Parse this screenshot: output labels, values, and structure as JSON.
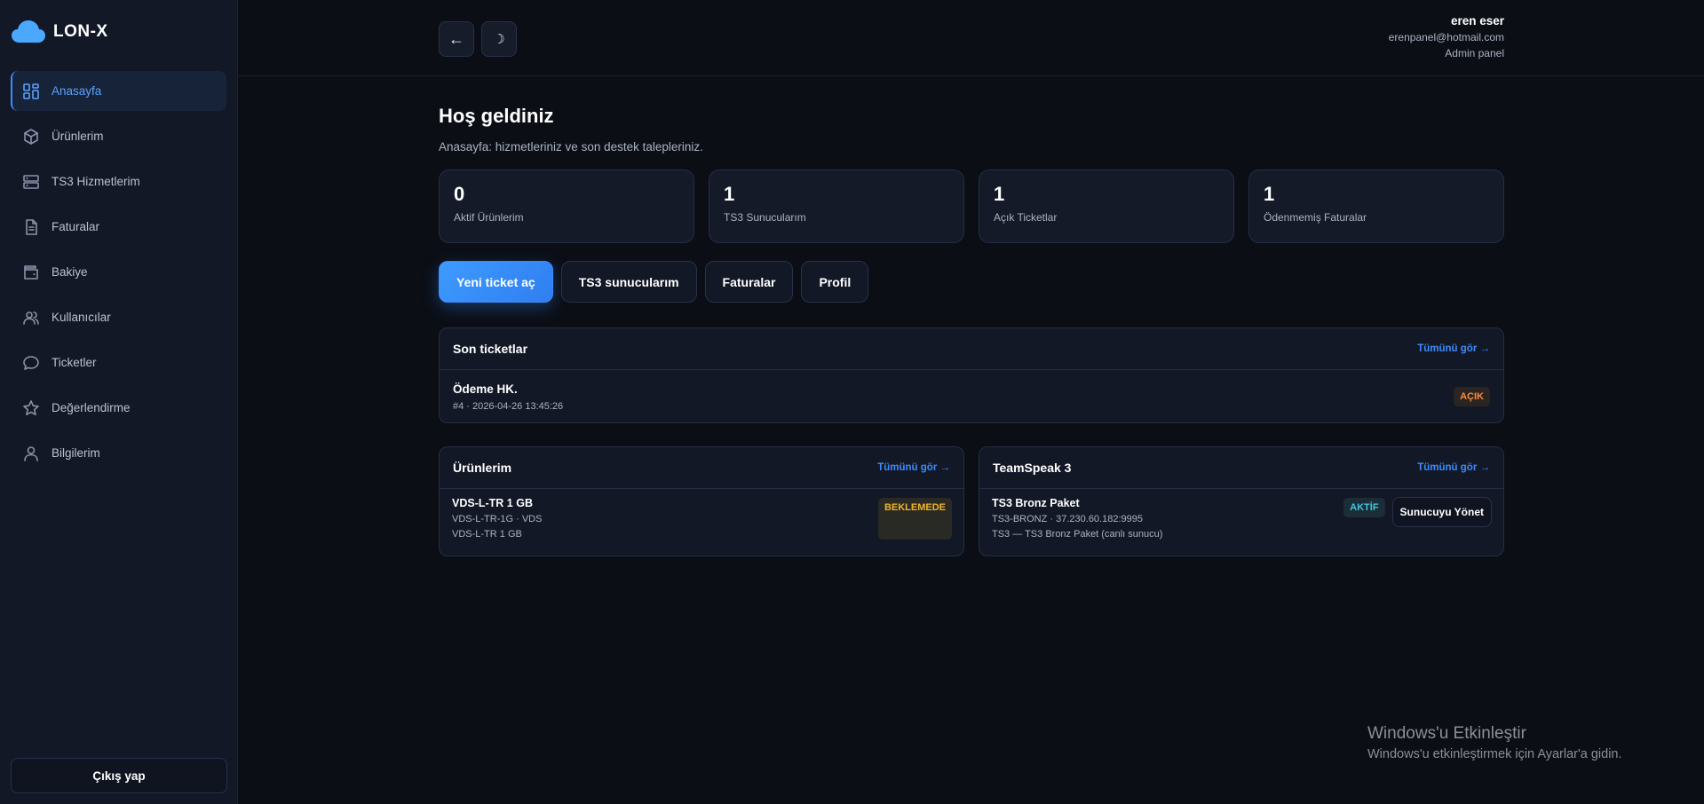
{
  "brand": {
    "name": "LON-X",
    "accent": "#3d8bfd"
  },
  "sidebar": {
    "items": [
      {
        "label": "Anasayfa",
        "icon": "dashboard-icon",
        "active": true
      },
      {
        "label": "Ürünlerim",
        "icon": "box-icon"
      },
      {
        "label": "TS3 Hizmetlerim",
        "icon": "server-icon"
      },
      {
        "label": "Faturalar",
        "icon": "document-icon"
      },
      {
        "label": "Bakiye",
        "icon": "wallet-icon"
      },
      {
        "label": "Kullanıcılar",
        "icon": "users-icon"
      },
      {
        "label": "Ticketler",
        "icon": "chat-icon"
      },
      {
        "label": "Değerlendirme",
        "icon": "star-icon"
      },
      {
        "label": "Bilgilerim",
        "icon": "user-icon"
      }
    ],
    "logout_label": "Çıkış yap"
  },
  "topbar": {
    "back_glyph": "←",
    "theme_glyph": "☽",
    "user": {
      "name": "eren eser",
      "email": "erenpanel@hotmail.com",
      "role": "Admin panel"
    }
  },
  "page": {
    "title": "Hoş geldiniz",
    "subtitle": "Anasayfa: hizmetleriniz ve son destek talepleriniz."
  },
  "stats": [
    {
      "value": "0",
      "label": "Aktif Ürünlerim"
    },
    {
      "value": "1",
      "label": "TS3 Sunucularım"
    },
    {
      "value": "1",
      "label": "Açık Ticketlar"
    },
    {
      "value": "1",
      "label": "Ödenmemiş Faturalar"
    }
  ],
  "actions": {
    "new_ticket": "Yeni ticket aç",
    "ts3_servers": "TS3 sunucularım",
    "invoices": "Faturalar",
    "profile": "Profil"
  },
  "tickets": {
    "title": "Son ticketlar",
    "see_all": "Tümünü gör →",
    "items": [
      {
        "title": "Ödeme HK.",
        "meta": "#4 · 2026-04-26 13:45:26",
        "status": "AÇIK"
      }
    ]
  },
  "products": {
    "title": "Ürünlerim",
    "see_all": "Tümünü gör →",
    "items": [
      {
        "title": "VDS-L-TR 1 GB",
        "sub": "VDS-L-TR-1G · VDS",
        "sub2": "VDS-L-TR 1 GB",
        "status": "BEKLEMEDE"
      }
    ]
  },
  "teamspeak": {
    "title": "TeamSpeak 3",
    "see_all": "Tümünü gör →",
    "items": [
      {
        "title": "TS3 Bronz Paket",
        "sub": "TS3-BRONZ · 37.230.60.182:9995",
        "sub2": "TS3 — TS3 Bronz Paket (canlı sunucu)",
        "status": "AKTİF",
        "manage": "Sunucuyu Yönet"
      }
    ]
  },
  "watermark": {
    "title": "Windows'u Etkinleştir",
    "subtitle": "Windows'u etkinleştirmek için Ayarlar'a gidin."
  }
}
